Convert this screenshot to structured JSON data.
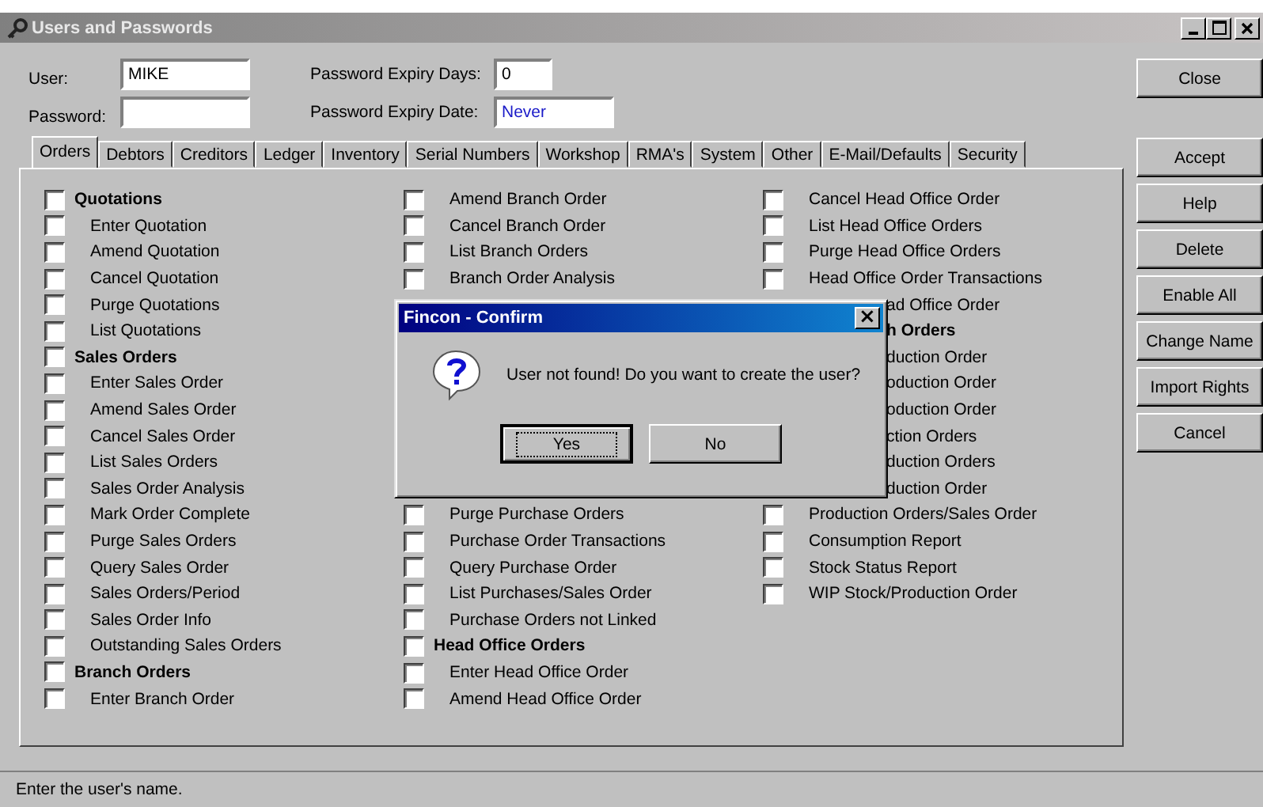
{
  "window": {
    "title": "Users and Passwords"
  },
  "fields": {
    "user_label": "User:",
    "user_value": "MIKE",
    "password_label": "Password:",
    "expiry_days_label": "Password Expiry Days:",
    "expiry_days_value": "0",
    "expiry_date_label": "Password Expiry Date:",
    "expiry_date_value": "Never"
  },
  "tabs": [
    {
      "label": "Orders",
      "selected": true
    },
    {
      "label": "Debtors",
      "selected": false
    },
    {
      "label": "Creditors",
      "selected": false
    },
    {
      "label": "Ledger",
      "selected": false
    },
    {
      "label": "Inventory",
      "selected": false
    },
    {
      "label": "Serial Numbers",
      "selected": false
    },
    {
      "label": "Workshop",
      "selected": false
    },
    {
      "label": "RMA's",
      "selected": false
    },
    {
      "label": "System",
      "selected": false
    },
    {
      "label": "Other",
      "selected": false
    },
    {
      "label": "E-Mail/Defaults",
      "selected": false
    },
    {
      "label": "Security",
      "selected": false
    }
  ],
  "columns": [
    {
      "upper": [
        {
          "kind": "group",
          "label": "Quotations",
          "checked": false
        },
        {
          "kind": "item",
          "label": "Enter Quotation",
          "checked": false
        },
        {
          "kind": "item",
          "label": "Amend Quotation",
          "checked": false
        },
        {
          "kind": "item",
          "label": "Cancel Quotation",
          "checked": false
        },
        {
          "kind": "item",
          "label": "Purge Quotations",
          "checked": false
        },
        {
          "kind": "item",
          "label": "List Quotations",
          "checked": false
        },
        {
          "kind": "group",
          "label": "Sales Orders",
          "checked": false
        },
        {
          "kind": "item",
          "label": "Enter Sales Order",
          "checked": false
        },
        {
          "kind": "item",
          "label": "Amend Sales Order",
          "checked": false
        },
        {
          "kind": "item",
          "label": "Cancel Sales Order",
          "checked": false
        },
        {
          "kind": "item",
          "label": "List Sales Orders",
          "checked": false
        },
        {
          "kind": "item",
          "label": "Sales Order Analysis",
          "checked": false
        },
        {
          "kind": "item",
          "label": "Mark Order Complete",
          "checked": false
        },
        {
          "kind": "item",
          "label": "Purge Sales Orders",
          "checked": false
        },
        {
          "kind": "item",
          "label": "Query Sales Order",
          "checked": false
        },
        {
          "kind": "item",
          "label": "Sales Orders/Period",
          "checked": false
        },
        {
          "kind": "item",
          "label": "Sales Order Info",
          "checked": false
        },
        {
          "kind": "item",
          "label": "Outstanding Sales Orders",
          "checked": false
        },
        {
          "kind": "group",
          "label": "Branch Orders",
          "checked": false
        },
        {
          "kind": "item",
          "label": "Enter Branch Order",
          "checked": false
        }
      ]
    },
    {
      "upper": [
        {
          "kind": "item",
          "label": "Amend Branch Order",
          "checked": false
        },
        {
          "kind": "item",
          "label": "Cancel Branch Order",
          "checked": false
        },
        {
          "kind": "item",
          "label": "List Branch Orders",
          "checked": false
        },
        {
          "kind": "item",
          "label": "Branch Order Analysis",
          "checked": false
        }
      ],
      "lower": [
        {
          "kind": "item",
          "label": "Purge Purchase Orders",
          "checked": false
        },
        {
          "kind": "item",
          "label": "Purchase Order Transactions",
          "checked": false
        },
        {
          "kind": "item",
          "label": "Query Purchase Order",
          "checked": false
        },
        {
          "kind": "item",
          "label": "List Purchases/Sales Order",
          "checked": false
        },
        {
          "kind": "item",
          "label": "Purchase Orders not Linked",
          "checked": false
        },
        {
          "kind": "group",
          "label": "Head Office Orders",
          "checked": false
        },
        {
          "kind": "item",
          "label": "Enter Head Office Order",
          "checked": false
        },
        {
          "kind": "item",
          "label": "Amend Head Office Order",
          "checked": false
        }
      ]
    },
    {
      "upper": [
        {
          "kind": "item",
          "label": "Cancel Head Office Order",
          "checked": false
        },
        {
          "kind": "item",
          "label": "List Head Office Orders",
          "checked": false
        },
        {
          "kind": "item",
          "label": "Purge Head Office Orders",
          "checked": false
        },
        {
          "kind": "item",
          "label": "Head Office Order Transactions",
          "checked": false
        }
      ],
      "partial": [
        {
          "kind": "item",
          "label": "ad Office Order"
        },
        {
          "kind": "group",
          "label": "h Orders"
        },
        {
          "kind": "item",
          "label": "duction Order"
        },
        {
          "kind": "item",
          "label": "oduction Order"
        },
        {
          "kind": "item",
          "label": "oduction Order"
        },
        {
          "kind": "item",
          "label": "ction Orders"
        },
        {
          "kind": "item",
          "label": "duction Orders"
        },
        {
          "kind": "item",
          "label": "duction Order"
        }
      ],
      "lower": [
        {
          "kind": "item",
          "label": "Production Orders/Sales Order",
          "checked": false
        },
        {
          "kind": "item",
          "label": "Consumption Report",
          "checked": false
        },
        {
          "kind": "item",
          "label": "Stock Status Report",
          "checked": false
        },
        {
          "kind": "item",
          "label": "WIP Stock/Production Order",
          "checked": false
        }
      ]
    }
  ],
  "side_buttons": [
    {
      "label": "Close"
    },
    {
      "label": "Accept"
    },
    {
      "label": "Help"
    },
    {
      "label": "Delete"
    },
    {
      "label": "Enable All"
    },
    {
      "label": "Change Name"
    },
    {
      "label": "Import Rights"
    },
    {
      "label": "Cancel"
    }
  ],
  "dialog": {
    "title": "Fincon - Confirm",
    "close": "×",
    "message": "User not found! Do you want to create the user?",
    "buttons": [
      {
        "label": "Yes",
        "selected": true
      },
      {
        "label": "No",
        "selected": false
      }
    ]
  },
  "status_bar": "Enter the user's name."
}
